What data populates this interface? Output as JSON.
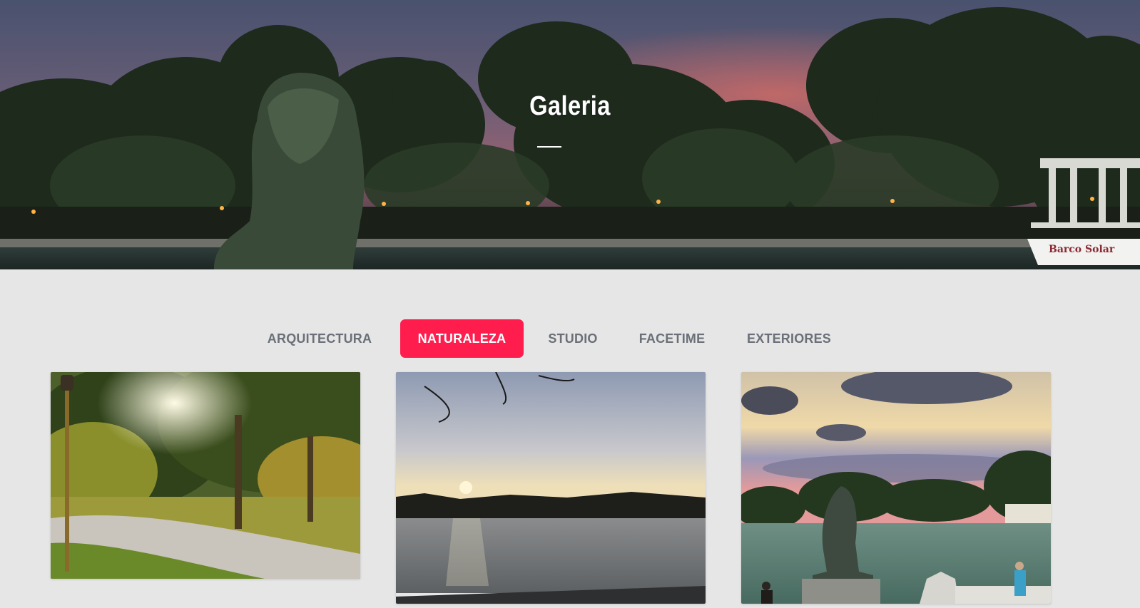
{
  "hero": {
    "title": "Galeria",
    "boat_sign": "Barco Solar"
  },
  "filters": {
    "active": "NATURALEZA",
    "items": [
      {
        "label": "ARQUITECTURA"
      },
      {
        "label": "NATURALEZA"
      },
      {
        "label": "STUDIO"
      },
      {
        "label": "FACETIME"
      },
      {
        "label": "EXTERIORES"
      }
    ]
  },
  "gallery": {
    "images": [
      {
        "subject": "park trees with lamp post at sunlight"
      },
      {
        "subject": "lake at sunset with boats"
      },
      {
        "subject": "lion statue by lake at dusk"
      }
    ]
  },
  "colors": {
    "accent": "#ff1d4e",
    "background": "#e6e6e6",
    "tab_text": "#6b7078"
  }
}
